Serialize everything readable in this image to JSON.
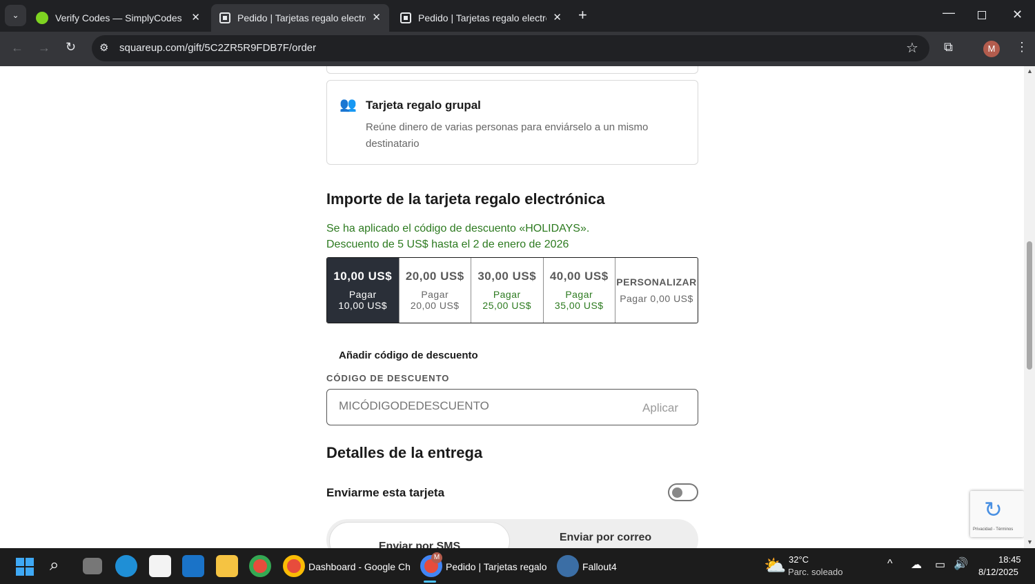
{
  "browser": {
    "tabs": [
      {
        "title": "Verify Codes — SimplyCodes",
        "active": false
      },
      {
        "title": "Pedido | Tarjetas regalo electrón",
        "active": true
      },
      {
        "title": "Pedido | Tarjetas regalo electrón",
        "active": false
      }
    ],
    "url": "squareup.com/gift/5C2ZR5R9FDB7F/order",
    "profile_initial": "M"
  },
  "page": {
    "group_card": {
      "title": "Tarjeta regalo grupal",
      "description": "Reúne dinero de varias personas para enviárselo a un mismo destinatario"
    },
    "amount_heading": "Importe de la tarjeta regalo electrónica",
    "discount_notice_1": "Se ha aplicado el código de descuento «HOLIDAYS».",
    "discount_notice_2": "Descuento de 5 US$ hasta el 2 de enero de 2026",
    "amounts": [
      {
        "value": "10,00 US$",
        "pay": "Pagar",
        "pay_amount": "10,00 US$",
        "selected": true
      },
      {
        "value": "20,00 US$",
        "pay": "Pagar",
        "pay_amount": "20,00 US$",
        "selected": false
      },
      {
        "value": "30,00 US$",
        "pay": "Pagar",
        "pay_amount": "25,00 US$",
        "selected": false
      },
      {
        "value": "40,00 US$",
        "pay": "Pagar",
        "pay_amount": "35,00 US$",
        "selected": false
      },
      {
        "value": "PERSONALIZAR",
        "pay": "Pagar 0,00 US$",
        "selected": false
      }
    ],
    "add_discount": "Añadir código de descuento",
    "discount_label": "CÓDIGO DE DESCUENTO",
    "discount_placeholder": "MICÓDIGODEDESCUENTO",
    "apply": "Aplicar",
    "delivery_heading": "Detalles de la entrega",
    "send_to_me": "Enviarme esta tarjeta",
    "send_sms": "Enviar por SMS",
    "send_email": "Enviar por correo",
    "recaptcha_text": "Privacidad - Términos"
  },
  "taskbar": {
    "apps": [
      "Dashboard - Google Ch",
      "Pedido | Tarjetas regalo",
      "Fallout4"
    ],
    "badge": "M",
    "weather_temp": "32°C",
    "weather_desc": "Parc. soleado",
    "time": "18:45",
    "date": "8/12/2025"
  },
  "colors": {
    "accent_selected": "#2a2f38",
    "discount_green": "#2c7a1f"
  }
}
